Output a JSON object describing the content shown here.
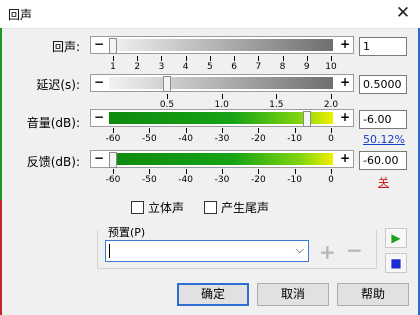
{
  "window": {
    "title": "回声",
    "close_glyph": "✕"
  },
  "rows": {
    "echo": {
      "label": "回声:",
      "value": "1",
      "ticks": [
        "1",
        "2",
        "3",
        "4",
        "5",
        "6",
        "7",
        "8",
        "9",
        "10"
      ]
    },
    "delay": {
      "label": "延迟(s):",
      "value": "0.5000",
      "ticks": [
        "0.5",
        "1.0",
        "1.5",
        "2.0"
      ]
    },
    "volume": {
      "label": "音量(dB):",
      "value": "-6.00",
      "percent": "50.12%",
      "ticks": [
        "-60",
        "-50",
        "-40",
        "-30",
        "-20",
        "-10",
        "0"
      ]
    },
    "feedback": {
      "label": "反馈(dB):",
      "value": "-60.00",
      "off_label": "关",
      "ticks": [
        "-60",
        "-50",
        "-40",
        "-30",
        "-20",
        "-10",
        "0"
      ]
    }
  },
  "slider_levels": {
    "echo": 0.0,
    "delay": 0.25,
    "volume": 0.9,
    "feedback": 0.0
  },
  "options": {
    "stereo": "立体声",
    "tail": "产生尾声"
  },
  "preset": {
    "label": "预置(P)",
    "value": ""
  },
  "buttons": {
    "ok": "确定",
    "cancel": "取消",
    "help": "帮助"
  },
  "icons": {
    "minus": "−",
    "plus": "+",
    "add": "+",
    "remove": "−",
    "play": "▶",
    "stop": "■",
    "dropdown": "⌵"
  },
  "colors": {
    "play": "#22a022",
    "stop": "#1a2bd0",
    "accent": "#2f6fd1"
  }
}
